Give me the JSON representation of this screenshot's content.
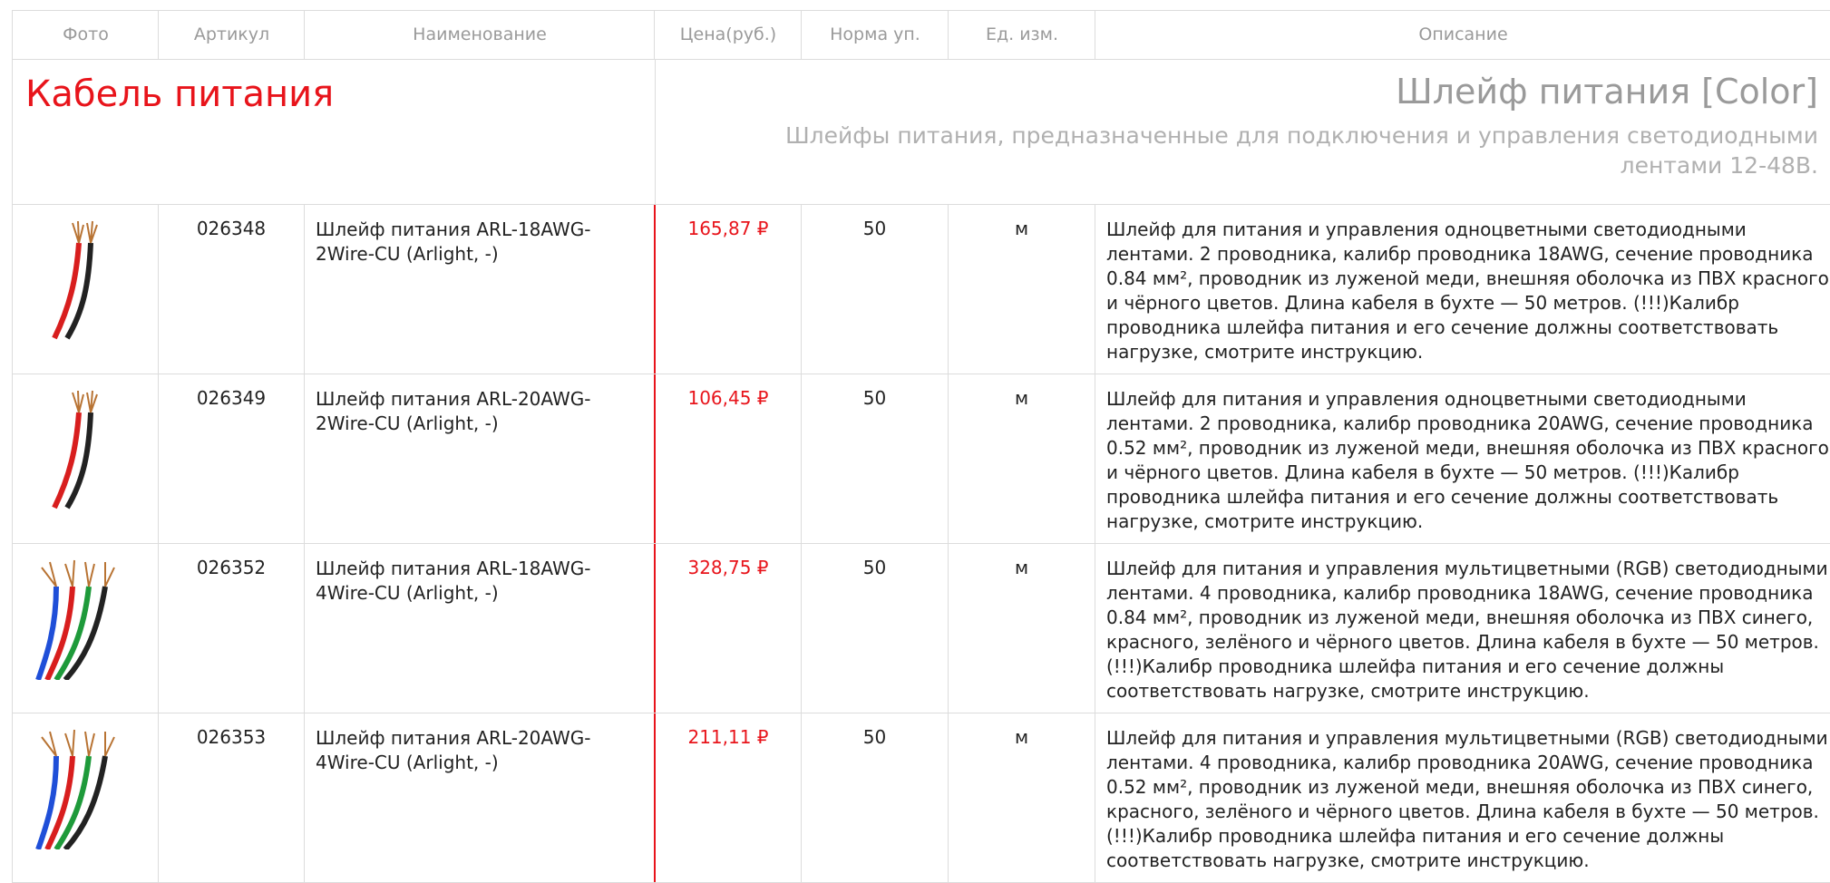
{
  "table": {
    "headers": [
      "Фото",
      "Артикул",
      "Наименование",
      "Цена(руб.)",
      "Норма уп.",
      "Ед. изм.",
      "Описание"
    ]
  },
  "section": {
    "category_title": "Кабель питания",
    "group_title": "Шлейф питания [Color]",
    "group_desc": "Шлейфы питания, предназначенные для подключения и управления светодиодными лентами 12-48В."
  },
  "colors": {
    "accent": "#e8141b",
    "header_text": "#9a9a9a",
    "border": "#dcdcdc"
  },
  "rows": [
    {
      "photo_icon": "two-wire-cable-icon",
      "article": "026348",
      "name": "Шлейф питания ARL-18AWG-2Wire-CU (Arlight, -)",
      "price": "165,87 ₽",
      "norm": "50",
      "unit": "м",
      "description": "Шлейф для питания и управления одноцветными светодиодными лентами. 2 проводника, калибр проводника 18AWG, сечение проводника 0.84 мм², проводник из луженой меди, внешняя оболочка из ПВХ красного и чёрного цветов. Длина кабеля в бухте — 50 метров. (!!!)Калибр проводника шлейфа питания и его сечение должны соответствовать нагрузке, смотрите инструкцию."
    },
    {
      "photo_icon": "two-wire-cable-icon",
      "article": "026349",
      "name": "Шлейф питания ARL-20AWG-2Wire-CU (Arlight, -)",
      "price": "106,45 ₽",
      "norm": "50",
      "unit": "м",
      "description": "Шлейф для питания и управления одноцветными светодиодными лентами. 2 проводника, калибр проводника 20AWG, сечение проводника 0.52 мм², проводник из луженой меди, внешняя оболочка из ПВХ красного и чёрного цветов. Длина кабеля в бухте — 50 метров. (!!!)Калибр проводника шлейфа питания и его сечение должны соответствовать нагрузке, смотрите инструкцию."
    },
    {
      "photo_icon": "four-wire-cable-icon",
      "article": "026352",
      "name": "Шлейф питания ARL-18AWG-4Wire-CU (Arlight, -)",
      "price": "328,75 ₽",
      "norm": "50",
      "unit": "м",
      "description": "Шлейф для питания и управления мультицветными (RGB) светодиодными лентами. 4 проводника, калибр проводника 18AWG, сечение проводника 0.84 мм², проводник из луженой меди, внешняя оболочка из ПВХ синего, красного, зелёного и чёрного цветов. Длина кабеля в бухте — 50 метров. (!!!)Калибр проводника шлейфа питания и его сечение должны соответствовать нагрузке, смотрите инструкцию."
    },
    {
      "photo_icon": "four-wire-cable-icon",
      "article": "026353",
      "name": "Шлейф питания ARL-20AWG-4Wire-CU (Arlight, -)",
      "price": "211,11 ₽",
      "norm": "50",
      "unit": "м",
      "description": "Шлейф для питания и управления мультицветными (RGB) светодиодными лентами. 4 проводника, калибр проводника 20AWG, сечение проводника 0.52 мм², проводник из луженой меди, внешняя оболочка из ПВХ синего, красного, зелёного и чёрного цветов. Длина кабеля в бухте — 50 метров. (!!!)Калибр проводника шлейфа питания и его сечение должны соответствовать нагрузке, смотрите инструкцию."
    }
  ]
}
